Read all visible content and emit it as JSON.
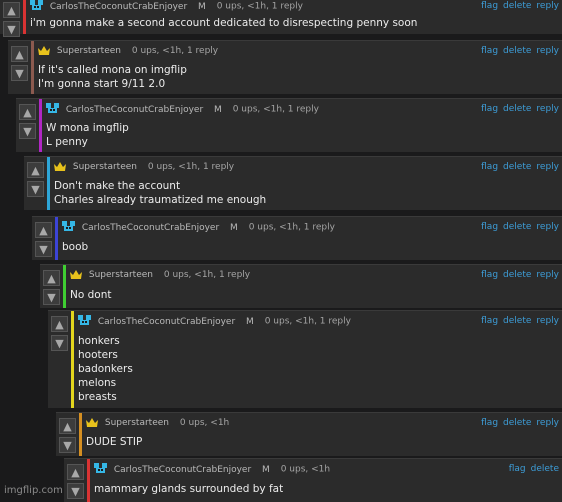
{
  "actions": {
    "flag": "flag",
    "delete": "delete",
    "reply": "reply"
  },
  "comments": [
    {
      "user": "CarlosTheCoconutCrabEnjoyer",
      "badge": "M",
      "stats": "0 ups, <1h, 1 reply",
      "text": "i'm gonna make a second account dedicated to disrespecting penny soon",
      "bar": "#d93333",
      "icon": "crab"
    },
    {
      "user": "Superstarteen",
      "badge": "",
      "stats": "0 ups, <1h, 1 reply",
      "text": "If it's called mona on imgflip\nI'm gonna start 9/11 2.0",
      "bar": "#8b5a4f",
      "icon": "crown"
    },
    {
      "user": "CarlosTheCoconutCrabEnjoyer",
      "badge": "M",
      "stats": "0 ups, <1h, 1 reply",
      "text": "W mona imgflip\nL penny",
      "bar": "#b127c4",
      "icon": "crab"
    },
    {
      "user": "Superstarteen",
      "badge": "",
      "stats": "0 ups, <1h, 1 reply",
      "text": "Don't make the account\nCharles already traumatized me enough",
      "bar": "#2ea6d8",
      "icon": "crown"
    },
    {
      "user": "CarlosTheCoconutCrabEnjoyer",
      "badge": "M",
      "stats": "0 ups, <1h, 1 reply",
      "text": "boob",
      "bar": "#3c44d6",
      "icon": "crab"
    },
    {
      "user": "Superstarteen",
      "badge": "",
      "stats": "0 ups, <1h, 1 reply",
      "text": "No dont",
      "bar": "#3fcf32",
      "icon": "crown"
    },
    {
      "user": "CarlosTheCoconutCrabEnjoyer",
      "badge": "M",
      "stats": "0 ups, <1h, 1 reply",
      "text": "honkers\nhooters\nbadonkers\nmelons\nbreasts",
      "bar": "#e3d51d",
      "icon": "crab"
    },
    {
      "user": "Superstarteen",
      "badge": "",
      "stats": "0 ups, <1h",
      "text": "DUDE STIP",
      "bar": "#d58f22",
      "icon": "crown"
    },
    {
      "user": "CarlosTheCoconutCrabEnjoyer",
      "badge": "M",
      "stats": "0 ups, <1h",
      "text": "mammary glands surrounded by fat",
      "bar": "#d93333",
      "icon": "crab"
    }
  ],
  "watermark": "imgflip.com"
}
